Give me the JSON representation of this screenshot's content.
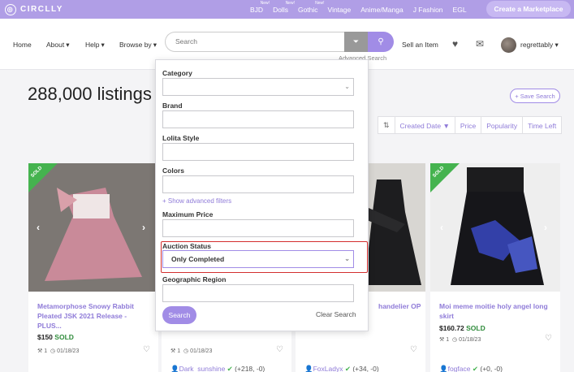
{
  "topbar": {
    "brand": "CIRCLLY",
    "nav": [
      {
        "label": "BJD",
        "new": "New!"
      },
      {
        "label": "Dolls",
        "new": "New!"
      },
      {
        "label": "Gothic",
        "new": "New!"
      },
      {
        "label": "Vintage",
        "new": ""
      },
      {
        "label": "Anime/Manga",
        "new": ""
      },
      {
        "label": "J Fashion",
        "new": ""
      },
      {
        "label": "EGL",
        "new": ""
      }
    ],
    "create_label": "Create a Marketplace"
  },
  "header": {
    "nav": [
      "Home",
      "About",
      "Help",
      "Browse by"
    ],
    "search_placeholder": "Search",
    "advanced_search_label": "Advanced Search",
    "sell_label": "Sell an Item",
    "username": "regrettably"
  },
  "main": {
    "listing_count": "288,000 listings",
    "save_search_label": "+ Save Search",
    "sort_options": [
      "Created Date ▼",
      "Price",
      "Popularity",
      "Time Left"
    ]
  },
  "advanced_search": {
    "category_label": "Category",
    "brand_label": "Brand",
    "lolita_style_label": "Lolita Style",
    "colors_label": "Colors",
    "show_advanced_filters": "+ Show advanced filters",
    "max_price_label": "Maximum Price",
    "auction_status_label": "Auction Status",
    "auction_status_value": "Only Completed",
    "geo_region_label": "Geographic Region",
    "search_button": "Search",
    "clear_button": "Clear Search"
  },
  "listings": [
    {
      "sold_badge": "SOLD",
      "title": "Metamorphose Snowy Rabbit Pleated JSK 2021 Release - PLUS...",
      "price": "$150",
      "status": "SOLD",
      "bids": "1",
      "date": "01/18/23",
      "seller": "",
      "rating": ""
    },
    {
      "sold_badge": "",
      "title": "",
      "price": "",
      "status": "",
      "bids": "1",
      "date": "01/18/23",
      "seller": "Dark_sunshine",
      "rating": "(+218, -0)"
    },
    {
      "sold_badge": "",
      "title": "handelier OP",
      "price": "",
      "status": "",
      "bids": "1",
      "date": "01/18/23",
      "seller": "FoxLadyx",
      "rating": "(+34, -0)"
    },
    {
      "sold_badge": "SOLD",
      "title": "Moi meme moitie holy angel long skirt",
      "price": "$160.72",
      "status": "SOLD",
      "bids": "1",
      "date": "01/18/23",
      "seller": "fogface",
      "rating": "(+0, -0)"
    }
  ],
  "colors": {
    "brand": "#b09ee6",
    "accent": "#a18ce6",
    "sold": "#45b34f",
    "highlight": "#d32f2f"
  }
}
